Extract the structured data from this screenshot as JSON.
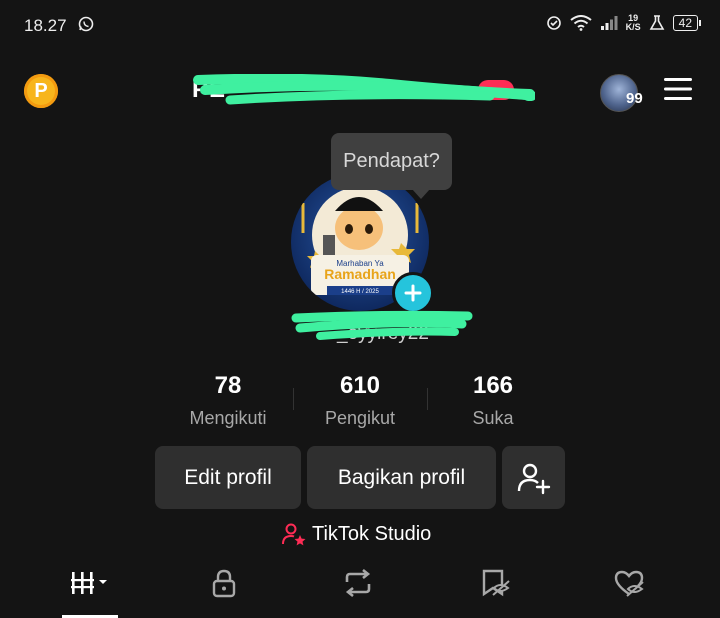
{
  "status_bar": {
    "time": "18.27",
    "net_speed_value": "19",
    "net_speed_unit": "K/S",
    "battery": "42",
    "icons": [
      "whatsapp-icon",
      "data-saver-icon",
      "wifi-icon",
      "signal-icon",
      "flask-icon",
      "battery-icon"
    ]
  },
  "header": {
    "username": "PE",
    "notification_count": "99",
    "coin_label": "P"
  },
  "tooltip": {
    "text": "Pendapat?"
  },
  "profile": {
    "avatar_caption_1": "Marhaban Ya",
    "avatar_caption_2": "Ramadhan",
    "avatar_caption_3": "1446 H / 2025",
    "handle": "_oyyirey22"
  },
  "stats": [
    {
      "value": "78",
      "label": "Mengikuti"
    },
    {
      "value": "610",
      "label": "Pengikut"
    },
    {
      "value": "166",
      "label": "Suka"
    }
  ],
  "actions": {
    "edit_profile": "Edit profil",
    "share_profile": "Bagikan profil"
  },
  "studio": {
    "label": "TikTok Studio"
  },
  "tabs": [
    "videos-tab",
    "private-tab",
    "reposts-tab",
    "favorites-tab",
    "liked-tab"
  ],
  "colors": {
    "background": "#141414",
    "accent_cyan": "#25c4dc",
    "redaction_green": "#3ff0a0",
    "tiktok_red": "#fe2c55",
    "coin": "#f7b51c"
  }
}
